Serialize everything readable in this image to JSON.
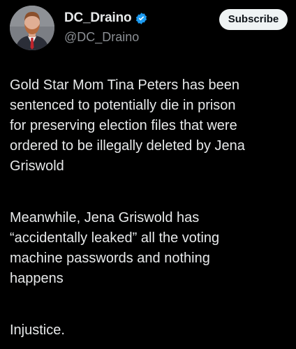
{
  "post": {
    "author": {
      "display_name": "DC_Draino",
      "handle": "@DC_Draino",
      "verified_icon": "verified-badge-icon",
      "avatar_icon": "profile-photo"
    },
    "subscribe_label": "Subscribe",
    "paragraphs": [
      "Gold Star Mom Tina Peters has been\nsentenced to potentially die in prison\nfor preserving election files that were\nordered to be illegally deleted by Jena\nGriswold",
      "Meanwhile, Jena Griswold has\n“accidentally leaked” all the voting\nmachine passwords and nothing\nhappens",
      "Injustice."
    ]
  },
  "colors": {
    "background": "#000000",
    "text": "#e7e9ea",
    "handle": "#8b8f94",
    "verified": "#1d9bf0",
    "button_bg": "#eff3f4",
    "button_text": "#0f1419"
  }
}
